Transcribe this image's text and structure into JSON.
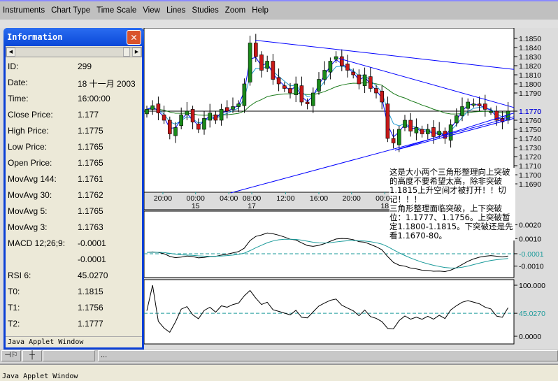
{
  "menu": [
    "Instruments",
    "Chart Type",
    "Time Scale",
    "View",
    "Lines",
    "Studies",
    "Zoom",
    "Help"
  ],
  "info": {
    "title": "Information",
    "rows": [
      {
        "k": "ID:",
        "v": "299"
      },
      {
        "k": "Date:",
        "v": "18 十一月 2003"
      },
      {
        "k": "Time:",
        "v": "16:00:00"
      },
      {
        "k": "Close Price:",
        "v": "1.177"
      },
      {
        "k": "High Price:",
        "v": "1.1775"
      },
      {
        "k": "Low Price:",
        "v": "1.1765"
      },
      {
        "k": "Open Price:",
        "v": "1.1765"
      },
      {
        "k": "MovAvg 144:",
        "v": "1.1761"
      },
      {
        "k": "MovAvg 30:",
        "v": "1.1762"
      },
      {
        "k": "MovAvg 5:",
        "v": "1.1765"
      },
      {
        "k": "MovAvg 3:",
        "v": "1.1763"
      },
      {
        "k": "MACD 12;26;9:",
        "v": "-0.0001"
      },
      {
        "k": "",
        "v": "-0.0001"
      },
      {
        "k": "RSI 6:",
        "v": "45.0270"
      },
      {
        "k": "T0:",
        "v": "1.1815"
      },
      {
        "k": "T1:",
        "v": "1.1756"
      },
      {
        "k": "T2:",
        "v": "1.1777"
      }
    ],
    "footer": "Java Applet Window"
  },
  "toolbar": {
    "more": "..."
  },
  "status": "Java Applet Window",
  "note": "这是大小两个三角形整理向上突破的高度不要希望太高，除非突破1.1815上升空间才被打开！！切记！！！\n三角形整理面临突破，上下突破位：1.1777、1.1756。上突破暂定1.1800-1.1815。下突破还是先看1.1670-80。",
  "chart_data": {
    "type": "candlestick",
    "closes": [
      1.1772,
      1.1776,
      1.1768,
      1.176,
      1.1745,
      1.1752,
      1.1766,
      1.177,
      1.1758,
      1.175,
      1.1762,
      1.1768,
      1.176,
      1.1772,
      1.177,
      1.1775,
      1.1778,
      1.18,
      1.1845,
      1.183,
      1.1815,
      1.1825,
      1.1805,
      1.18,
      1.1795,
      1.179,
      1.18,
      1.178,
      1.1778,
      1.179,
      1.1805,
      1.1815,
      1.1825,
      1.183,
      1.182,
      1.1815,
      1.181,
      1.18,
      1.181,
      1.1795,
      1.179,
      1.178,
      1.174,
      1.1735,
      1.175,
      1.176,
      1.1748,
      1.1752,
      1.1745,
      1.175,
      1.1742,
      1.1748,
      1.174,
      1.1755,
      1.1765,
      1.1775,
      1.178,
      1.1778,
      1.1776,
      1.1772,
      1.177,
      1.176,
      1.1758,
      1.177
    ],
    "price_ticks": [
      "1.1850",
      "1.1840",
      "1.1830",
      "1.1820",
      "1.1810",
      "1.1800",
      "1.1790",
      "1.1770",
      "1.1760",
      "1.1750",
      "1.1740",
      "1.1730",
      "1.1720",
      "1.1710",
      "1.1700",
      "1.1690"
    ],
    "current_price": "1.1770",
    "price_range": [
      1.1678,
      1.1866
    ],
    "time_labels": [
      {
        "i": 2.8,
        "t": "20:00",
        "d": ""
      },
      {
        "i": 8.5,
        "t": "00:00",
        "d": "15"
      },
      {
        "i": 14.3,
        "t": "04:00",
        "d": ""
      },
      {
        "i": 18.3,
        "t": "08:00",
        "d": "17"
      },
      {
        "i": 24.2,
        "t": "12:00",
        "d": ""
      },
      {
        "i": 30,
        "t": "16:00",
        "d": ""
      },
      {
        "i": 35.7,
        "t": "20:00",
        "d": ""
      },
      {
        "i": 41.5,
        "t": "00:00",
        "d": "18"
      }
    ],
    "trendlines": [
      {
        "i0": 18.9,
        "p0": 1.1848,
        "i1": 64.4,
        "p1": 1.1816
      },
      {
        "i0": 33.5,
        "p0": 1.1828,
        "i1": 64.4,
        "p1": 1.1774
      },
      {
        "i0": 43.3,
        "p0": 1.1727,
        "i1": 64.4,
        "p1": 1.1762
      },
      {
        "i0": 43.3,
        "p0": 1.1727,
        "i1": 64.4,
        "p1": 1.1768
      },
      {
        "i0": 14.6,
        "p0": 1.168,
        "i1": 64.4,
        "p1": 1.1764
      }
    ],
    "macd_ticks": [
      "0.0020",
      "0.0010",
      "-0.0001",
      "-0.0010"
    ],
    "macd_current": "-0.0001",
    "rsi_ticks": [
      "100.000",
      "45.0270",
      "0.0000"
    ],
    "rsi_current": "45.0270",
    "colors": {
      "up": "#1a8a1a",
      "down": "#c81818",
      "ma3": "#0000ff",
      "ma5": "#1e9ad0",
      "ma144": "#1a7a1a",
      "trend": "#0000ff",
      "signal": "#1a9a9a"
    }
  }
}
